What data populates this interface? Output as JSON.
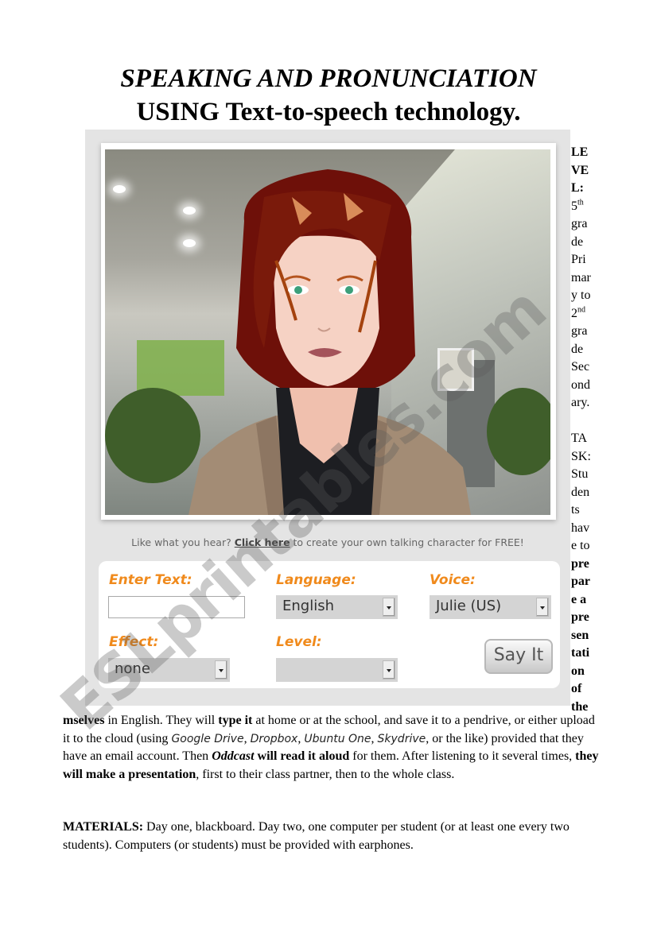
{
  "title": {
    "line1": "SPEAKING AND PRONUNCIATION",
    "line2": "USING Text-to-speech technology."
  },
  "widget": {
    "promo_prefix": "Like what you hear? ",
    "promo_link": "Click here",
    "promo_suffix": " to create your own talking character for FREE!",
    "enter_text_label": "Enter Text:",
    "enter_text_value": "",
    "language_label": "Language:",
    "language_value": "English",
    "voice_label": "Voice:",
    "voice_value": "Julie (US)",
    "effect_label": "Effect:",
    "effect_value": "none",
    "level_label": "Level:",
    "level_value": "",
    "say_it_label": "Say It",
    "avatar_image": "talking-character-avatar",
    "colors": {
      "label_orange": "#f08a1c",
      "widget_bg": "#e4e4e4"
    }
  },
  "side_column": {
    "level_lines": [
      "LE",
      "VE",
      "L:"
    ],
    "level_text": [
      {
        "text": "5",
        "sup": "th"
      },
      {
        "text": "gra"
      },
      {
        "text": "de"
      },
      {
        "text": "Pri"
      },
      {
        "text": "mar"
      },
      {
        "text": "y to"
      },
      {
        "text": "2",
        "sup": "nd"
      },
      {
        "text": "gra"
      },
      {
        "text": "de"
      },
      {
        "text": "Sec"
      },
      {
        "text": "ond"
      },
      {
        "text": "ary."
      }
    ],
    "task_lines": [
      "TA",
      "SK:",
      "Stu",
      "den",
      "ts",
      "hav",
      "e to"
    ],
    "task_bold_lines": [
      "pre",
      "par",
      "e a",
      "pre",
      "sen",
      "tati",
      "on",
      "of",
      "the"
    ]
  },
  "paragraph_task": {
    "p1_bold": "mselves",
    "p1_a": " in English. They will ",
    "p1_bold2": "type it",
    "p1_b": " at home or at the school, and save it to a pendrive, or either upload it to the cloud (using ",
    "gd": "Google Drive",
    "sep1": ", ",
    "db": "Dropbox",
    "sep2": ", ",
    "uo": "Ubuntu One",
    "sep3": ", ",
    "sd": "Skydrive",
    "p1_c": ", or the like) provided that they have an email account. Then ",
    "oddcast": "Oddcast",
    "will": " will read it aloud",
    "p1_d": " for them. After listening to it several times, ",
    "make": "they will make a presentation",
    "p1_e": ", first to their class partner, then to the whole class."
  },
  "paragraph_materials": {
    "label": "MATERIALS:",
    "text": " Day one, blackboard. Day two, one computer per student (or at least one every two students). Computers (or students) must be provided with earphones."
  },
  "watermark": "ESLprintables.com"
}
